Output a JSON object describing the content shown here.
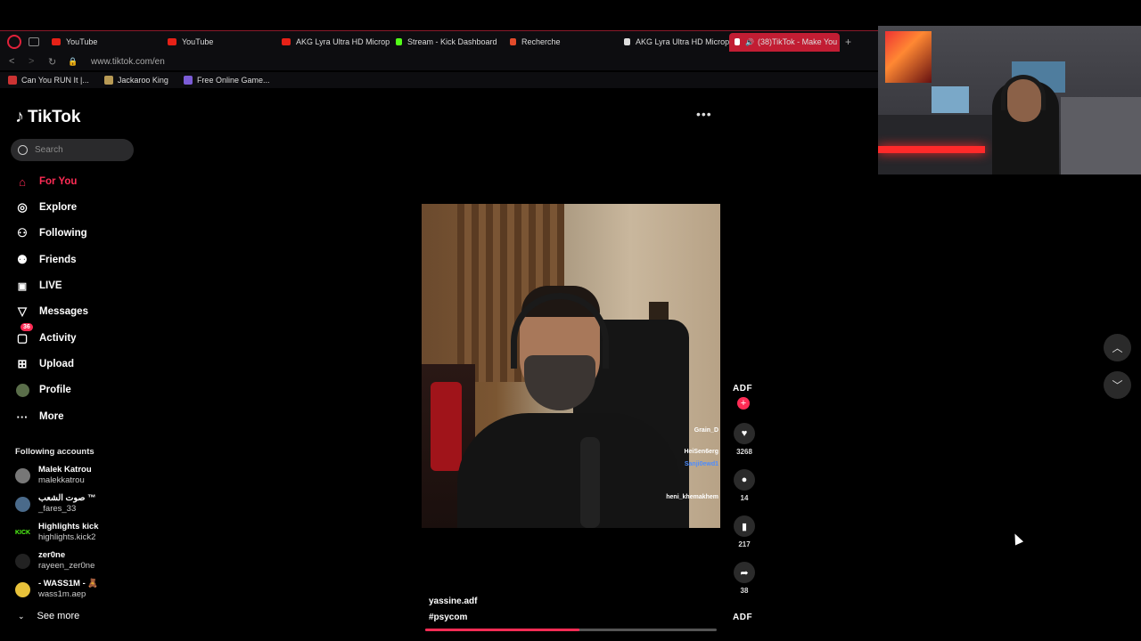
{
  "browser": {
    "tabs": [
      {
        "label": "YouTube",
        "color": "#e62117"
      },
      {
        "label": "YouTube",
        "color": "#e62117"
      },
      {
        "label": "AKG Lyra Ultra HD Microp",
        "color": "#e62117"
      },
      {
        "label": "Stream - Kick Dashboard",
        "color": "#53fc18"
      },
      {
        "label": "Recherche",
        "color": "#e24b2b"
      },
      {
        "label": "AKG Lyra Ultra HD Microp",
        "color": "#dddddd"
      },
      {
        "label": "(38)TikTok - Make You",
        "color": "#ffffff"
      }
    ],
    "url": "www.tiktok.com/en",
    "bookmarks": [
      {
        "label": "Can You RUN It |..."
      },
      {
        "label": "Jackaroo King"
      },
      {
        "label": "Free Online Game..."
      }
    ]
  },
  "sidebar": {
    "logo": "TikTok",
    "search_placeholder": "Search",
    "nav": [
      {
        "label": "For You",
        "icon": "home-icon"
      },
      {
        "label": "Explore",
        "icon": "compass-icon"
      },
      {
        "label": "Following",
        "icon": "user-plus-icon"
      },
      {
        "label": "Friends",
        "icon": "users-icon"
      },
      {
        "label": "LIVE",
        "icon": "live-icon"
      },
      {
        "label": "Messages",
        "icon": "send-icon"
      },
      {
        "label": "Activity",
        "icon": "inbox-icon",
        "badge": "36"
      },
      {
        "label": "Upload",
        "icon": "plus-square-icon"
      },
      {
        "label": "Profile",
        "icon": "avatar"
      },
      {
        "label": "More",
        "icon": "dots-icon"
      }
    ],
    "following_title": "Following accounts",
    "accounts": [
      {
        "name": "Malek Katrou",
        "handle": "malekkatrou"
      },
      {
        "name": "صوت الشعب ™",
        "handle": "_fares_33"
      },
      {
        "name": "Highlights kick",
        "handle": "highlights.kick2",
        "avatar_text": "KICK"
      },
      {
        "name": "zer0ne",
        "handle": "rayeen_zer0ne"
      },
      {
        "name": "- WASS1M - 🧸",
        "handle": "wass1m.aep"
      }
    ],
    "see_more": "See more"
  },
  "video": {
    "chat": [
      {
        "text": "Grain_D",
        "color": "#ffffff"
      },
      {
        "text": "HeiSen6erg",
        "color": "#ffffff"
      },
      {
        "text": "Sanji0ewd1",
        "color": "#4c8cff"
      },
      {
        "text": "heni_khemakhem",
        "color": "#ffffff"
      }
    ],
    "author": "yassine.adf",
    "hashtag": "#psycom",
    "progress": 0.53
  },
  "actions": {
    "creator_logo": "ADF",
    "likes": "3268",
    "comments": "14",
    "saves": "217",
    "shares": "38",
    "music_logo": "ADF"
  },
  "colors": {
    "accent": "#fe2c55",
    "background": "#000000"
  }
}
